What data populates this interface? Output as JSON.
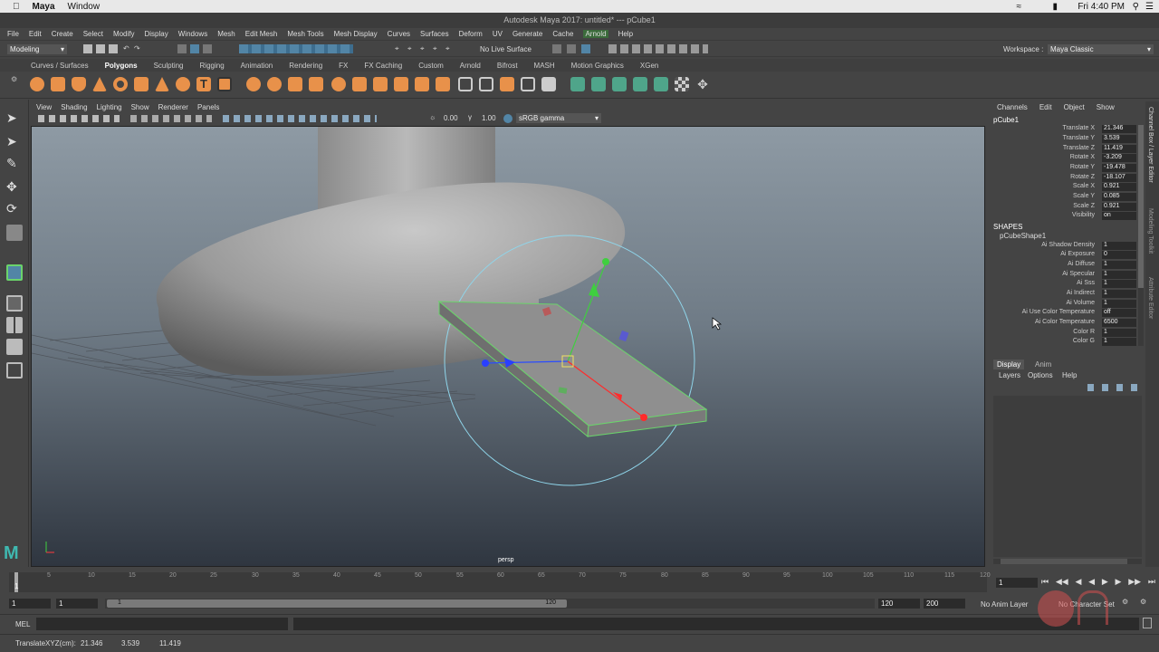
{
  "mac_menubar": {
    "apple": "",
    "app": "Maya",
    "window": "Window",
    "clock": "Fri 4:40 PM"
  },
  "titlebar": {
    "title": "Autodesk Maya 2017: untitled*    ---    pCube1"
  },
  "menus": [
    "File",
    "Edit",
    "Create",
    "Select",
    "Modify",
    "Display",
    "Windows",
    "Mesh",
    "Edit Mesh",
    "Mesh Tools",
    "Mesh Display",
    "Curves",
    "Surfaces",
    "Deform",
    "UV",
    "Generate",
    "Cache",
    "Arnold",
    "Help"
  ],
  "statusline": {
    "menu_set": "Modeling",
    "live_surface": "No Live Surface",
    "workspace_label": "Workspace :",
    "workspace_value": "Maya Classic"
  },
  "shelf_tabs": [
    "Curves / Surfaces",
    "Polygons",
    "Sculpting",
    "Rigging",
    "Animation",
    "Rendering",
    "FX",
    "FX Caching",
    "Custom",
    "Arnold",
    "Bifrost",
    "MASH",
    "Motion Graphics",
    "XGen"
  ],
  "shelf_active": "Polygons",
  "panel_menus": [
    "View",
    "Shading",
    "Lighting",
    "Show",
    "Renderer",
    "Panels"
  ],
  "panel_toolbar": {
    "exposure": "0.00",
    "gamma": "1.00",
    "color_space": "sRGB gamma"
  },
  "viewport": {
    "camera": "persp"
  },
  "channel_box": {
    "menus": [
      "Channels",
      "Edit",
      "Object",
      "Show"
    ],
    "object": "pCube1",
    "attributes": [
      {
        "label": "Translate X",
        "value": "21.346"
      },
      {
        "label": "Translate Y",
        "value": "3.539"
      },
      {
        "label": "Translate Z",
        "value": "11.419"
      },
      {
        "label": "Rotate X",
        "value": "-3.209"
      },
      {
        "label": "Rotate Y",
        "value": "-19.478"
      },
      {
        "label": "Rotate Z",
        "value": "-18.107"
      },
      {
        "label": "Scale X",
        "value": "0.921"
      },
      {
        "label": "Scale Y",
        "value": "0.085"
      },
      {
        "label": "Scale Z",
        "value": "0.921"
      },
      {
        "label": "Visibility",
        "value": "on"
      }
    ],
    "shapes_header": "SHAPES",
    "shape_name": "pCubeShape1",
    "shape_attributes": [
      {
        "label": "Ai Shadow Density",
        "value": "1"
      },
      {
        "label": "Ai Exposure",
        "value": "0"
      },
      {
        "label": "Ai Diffuse",
        "value": "1"
      },
      {
        "label": "Ai Specular",
        "value": "1"
      },
      {
        "label": "Ai Sss",
        "value": "1"
      },
      {
        "label": "Ai Indirect",
        "value": "1"
      },
      {
        "label": "Ai Volume",
        "value": "1"
      },
      {
        "label": "Ai Use Color Temperature",
        "value": "off"
      },
      {
        "label": "Ai Color Temperature",
        "value": "6500"
      },
      {
        "label": "Color R",
        "value": "1"
      },
      {
        "label": "Color G",
        "value": "1"
      }
    ]
  },
  "side_tabs": [
    "Channel Box / Layer Editor",
    "Modeling Toolkit",
    "Attribute Editor"
  ],
  "layer_editor": {
    "tabs": [
      "Display",
      "Anim"
    ],
    "menus": [
      "Layers",
      "Options",
      "Help"
    ]
  },
  "timeline": {
    "ticks": [
      "1",
      "5",
      "10",
      "15",
      "20",
      "25",
      "30",
      "35",
      "40",
      "45",
      "50",
      "55",
      "60",
      "65",
      "70",
      "75",
      "80",
      "85",
      "90",
      "95",
      "100",
      "105",
      "110",
      "115",
      "120"
    ],
    "current_frame": "1",
    "current_field": "1"
  },
  "range": {
    "start": "1",
    "inner_start": "1",
    "slider_start": "1",
    "slider_end": "120",
    "end": "120",
    "outer_end": "200",
    "anim_layer": "No Anim Layer",
    "char_set": "No Character Set"
  },
  "cmdline": {
    "lang": "MEL"
  },
  "helpline": {
    "label": "TranslateXYZ(cm):",
    "x": "21.346",
    "y": "3.539",
    "z": "11.419"
  },
  "colors": {
    "accent": "#5285a6",
    "shelf_orange": "#e8914a",
    "shelf_green": "#4fa58a",
    "selection_green": "#6bd36b"
  }
}
